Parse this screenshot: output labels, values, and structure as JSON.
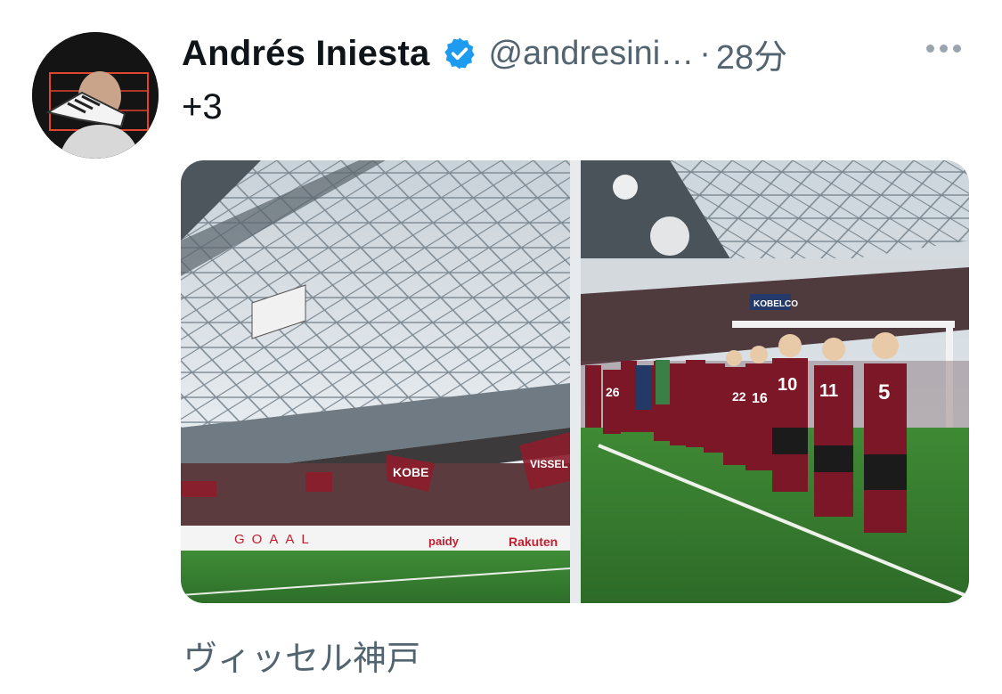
{
  "tweet": {
    "author_name": "Andrés Iniesta",
    "handle": "@andresini…",
    "separator": "·",
    "time": "28分",
    "extra_count": "+3",
    "caption": "ヴィッセル神戸",
    "verified_color": "#1d9bf0"
  },
  "icons": {
    "verified": "verified-badge-icon",
    "more": "more-options-icon"
  },
  "media": {
    "left_photo_signage": [
      "GOAAL",
      "paidy",
      "Rakuten",
      "KOBE"
    ],
    "right_photo_signage": [
      "KOBELCO"
    ],
    "player_numbers": [
      "26",
      "22",
      "16",
      "10",
      "11",
      "5"
    ]
  }
}
